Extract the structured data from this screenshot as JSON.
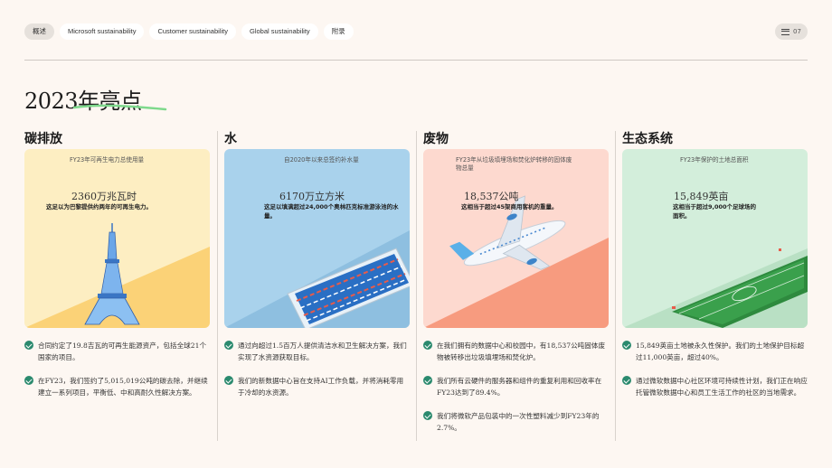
{
  "nav": {
    "tabs": [
      {
        "label": "概述"
      },
      {
        "label": "Microsoft sustainability"
      },
      {
        "label": "Customer sustainability"
      },
      {
        "label": "Global sustainability"
      },
      {
        "label": "附录"
      }
    ],
    "page_number": "07",
    "menu_icon": "hamburger-icon"
  },
  "page_title": "2023年亮点",
  "sections": [
    {
      "heading": "碳排放",
      "card": {
        "label": "FY23年可再生电力总使用量",
        "value": "2360万兆瓦时",
        "description": "这足以为巴黎提供约两年的可再生电力。",
        "color": "#fdeec2",
        "illustration": "eiffel-tower"
      },
      "bullets": [
        "合同约定了19.8吉瓦的可再生能源资产，包括全球21个国家的项目。",
        "在FY23，我们签约了5,015,019公吨的碳去除，并继续建立一系列项目，平衡低、中和高耐久性解决方案。"
      ]
    },
    {
      "heading": "水",
      "card": {
        "label": "自2020年以来总签约补水量",
        "value": "6170万立方米",
        "description": "这足以填满超过24,000个奥林匹克标准游泳池的水量。",
        "color": "#a9d2ec",
        "illustration": "swimming-pool"
      },
      "bullets": [
        "通过向超过1.5百万人提供清洁水和卫生解决方案，我们实现了水资源获取目标。",
        "我们的新数据中心旨在支持AI工作负载，并将消耗零用于冷却的水资源。"
      ]
    },
    {
      "heading": "废物",
      "card": {
        "label": "FY23年从垃圾填埋场和焚化炉转移的固体废物总量",
        "value": "18,537公吨",
        "description": "这相当于超过45架商用客机的重量。",
        "color": "#fdd9cf",
        "illustration": "airplane"
      },
      "bullets": [
        "在我们拥有的数据中心和校园中，有18,537公吨固体废物被转移出垃圾填埋场和焚化炉。",
        "我们所有云硬件的服务器和组件的重复利用和回收率在FY23达到了89.4%。",
        "我们将微软产品包装中的一次性塑料减少到FY23年的2.7%。"
      ]
    },
    {
      "heading": "生态系统",
      "card": {
        "label": "FY23年保护的土地总面积",
        "value": "15,849英亩",
        "description": "这相当于超过9,000个足球场的面积。",
        "color": "#d3eedb",
        "illustration": "soccer-field"
      },
      "bullets": [
        "15,849英亩土地被永久性保护。我们的土地保护目标超过11,000英亩，超过40%。",
        "通过微软数据中心社区环境可持续性计划，我们正在响应托管微软数据中心和员工生活工作的社区的当地需求。"
      ]
    }
  ]
}
